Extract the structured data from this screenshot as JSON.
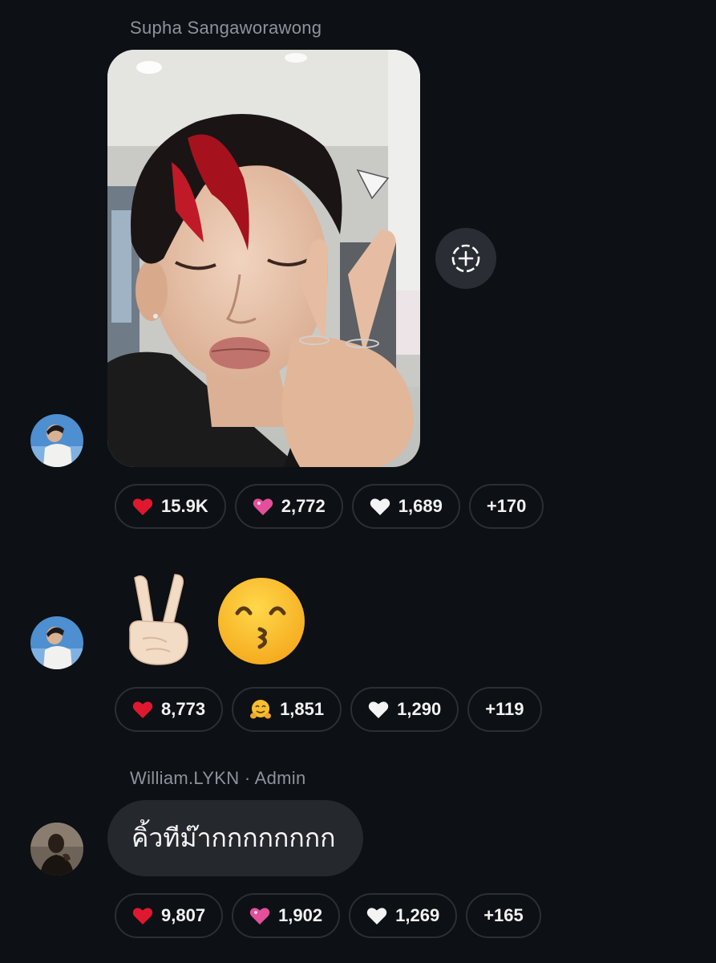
{
  "messages": [
    {
      "sender": "Supha Sangaworawong",
      "type": "photo",
      "reactions": [
        {
          "emoji": "heart-red",
          "count": "15.9K"
        },
        {
          "emoji": "heart-pink",
          "count": "2,772"
        },
        {
          "emoji": "heart-white",
          "count": "1,689"
        },
        {
          "emoji": "more",
          "count": "+170"
        }
      ]
    },
    {
      "type": "emoji",
      "emojis": [
        "victory-hand-emoji",
        "kissing-face-smiling-eyes-emoji"
      ],
      "reactions": [
        {
          "emoji": "heart-red",
          "count": "8,773"
        },
        {
          "emoji": "hugging-face",
          "count": "1,851"
        },
        {
          "emoji": "heart-white",
          "count": "1,290"
        },
        {
          "emoji": "more",
          "count": "+119"
        }
      ]
    },
    {
      "sender": "William.LYKN · Admin",
      "type": "text",
      "text": "คิ้วทีม๊ากกกกกกกก",
      "reactions": [
        {
          "emoji": "heart-red",
          "count": "9,807"
        },
        {
          "emoji": "heart-pink",
          "count": "1,902"
        },
        {
          "emoji": "heart-white",
          "count": "1,269"
        },
        {
          "emoji": "more",
          "count": "+165"
        }
      ]
    }
  ],
  "icons": {
    "share": "add-circle-dashed-icon"
  },
  "colors": {
    "background": "#0d1014",
    "pill_border": "#2b2f35",
    "bubble": "#25282d",
    "muted_text": "#8e939b",
    "heart_red": "#e0182f",
    "heart_pink": "#e34f9b"
  }
}
